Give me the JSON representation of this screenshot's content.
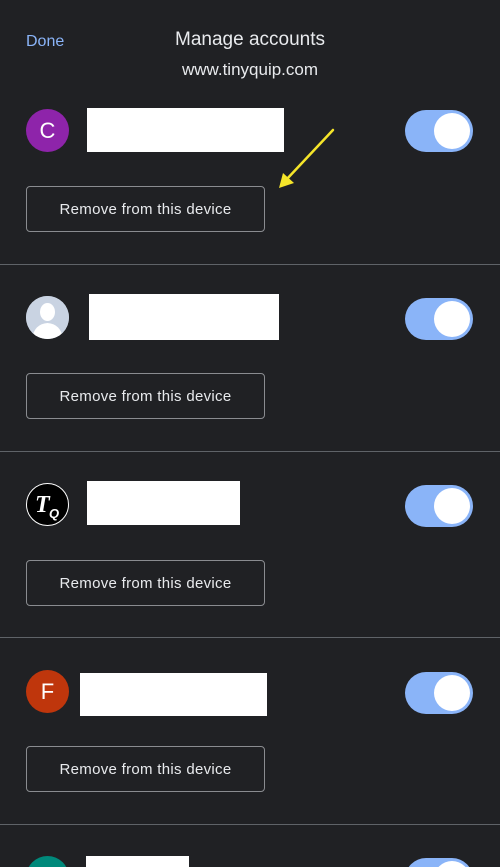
{
  "header": {
    "done_label": "Done",
    "title": "Manage accounts",
    "subtitle": "www.tinyquip.com"
  },
  "accounts": [
    {
      "avatar_letter": "C",
      "avatar_color": "#8e24aa",
      "toggle_on": true,
      "remove_label": "Remove from this device"
    },
    {
      "avatar_letter": "",
      "avatar_icon": "person-silhouette-icon",
      "toggle_on": true,
      "remove_label": "Remove from this device"
    },
    {
      "avatar_letter": "TQ",
      "avatar_color": "#000000",
      "toggle_on": true,
      "remove_label": "Remove from this device"
    },
    {
      "avatar_letter": "F",
      "avatar_color": "#bf360c",
      "toggle_on": true,
      "remove_label": "Remove from this device"
    },
    {
      "avatar_letter": "",
      "avatar_color": "#00897b",
      "toggle_on": true
    }
  ],
  "colors": {
    "background": "#202124",
    "accent": "#8ab4f8",
    "annotation_arrow": "#f5e52a"
  }
}
